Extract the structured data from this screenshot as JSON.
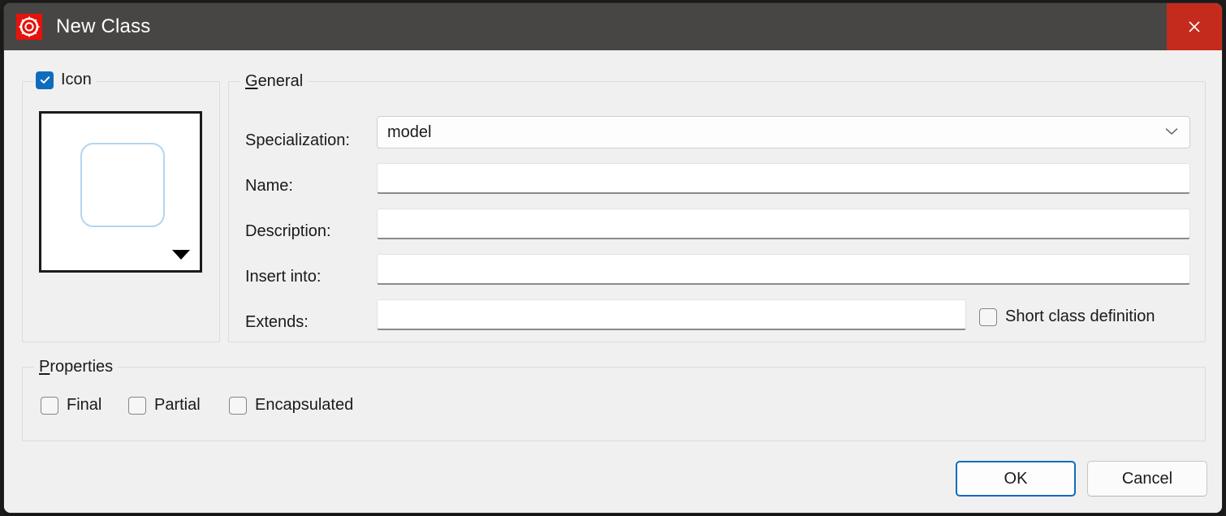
{
  "window": {
    "title": "New Class",
    "app_icon": "openmodelica-logo-icon",
    "close_label": "✕",
    "titlebar_color": "#484644",
    "close_hover_color": "#c42b1c",
    "accent_color": "#0f6cbd"
  },
  "icon_group": {
    "label": "Icon",
    "checked": true,
    "preview_shape": "rounded-rectangle",
    "preview_shape_color": "#b3d5f0",
    "dropdown_caret": "caret-down-icon"
  },
  "general_group": {
    "label": "General",
    "mnemonic": "G",
    "specialization": {
      "label": "Specialization:",
      "value": "model",
      "placeholder": "",
      "caret": "chevron-down-icon"
    },
    "name": {
      "label": "Name:",
      "value": "",
      "placeholder": ""
    },
    "description": {
      "label": "Description:",
      "value": "",
      "placeholder": ""
    },
    "insert_into": {
      "label": "Insert into:",
      "value": "",
      "placeholder": ""
    },
    "extends": {
      "label": "Extends:",
      "value": "",
      "placeholder": ""
    },
    "short_class_definition": {
      "label": "Short class definition",
      "checked": false
    }
  },
  "properties_group": {
    "label": "Properties",
    "mnemonic": "P",
    "items": [
      {
        "label": "Final",
        "checked": false
      },
      {
        "label": "Partial",
        "checked": false
      },
      {
        "label": "Encapsulated",
        "checked": false
      }
    ]
  },
  "footer": {
    "ok_label": "OK",
    "cancel_label": "Cancel"
  }
}
